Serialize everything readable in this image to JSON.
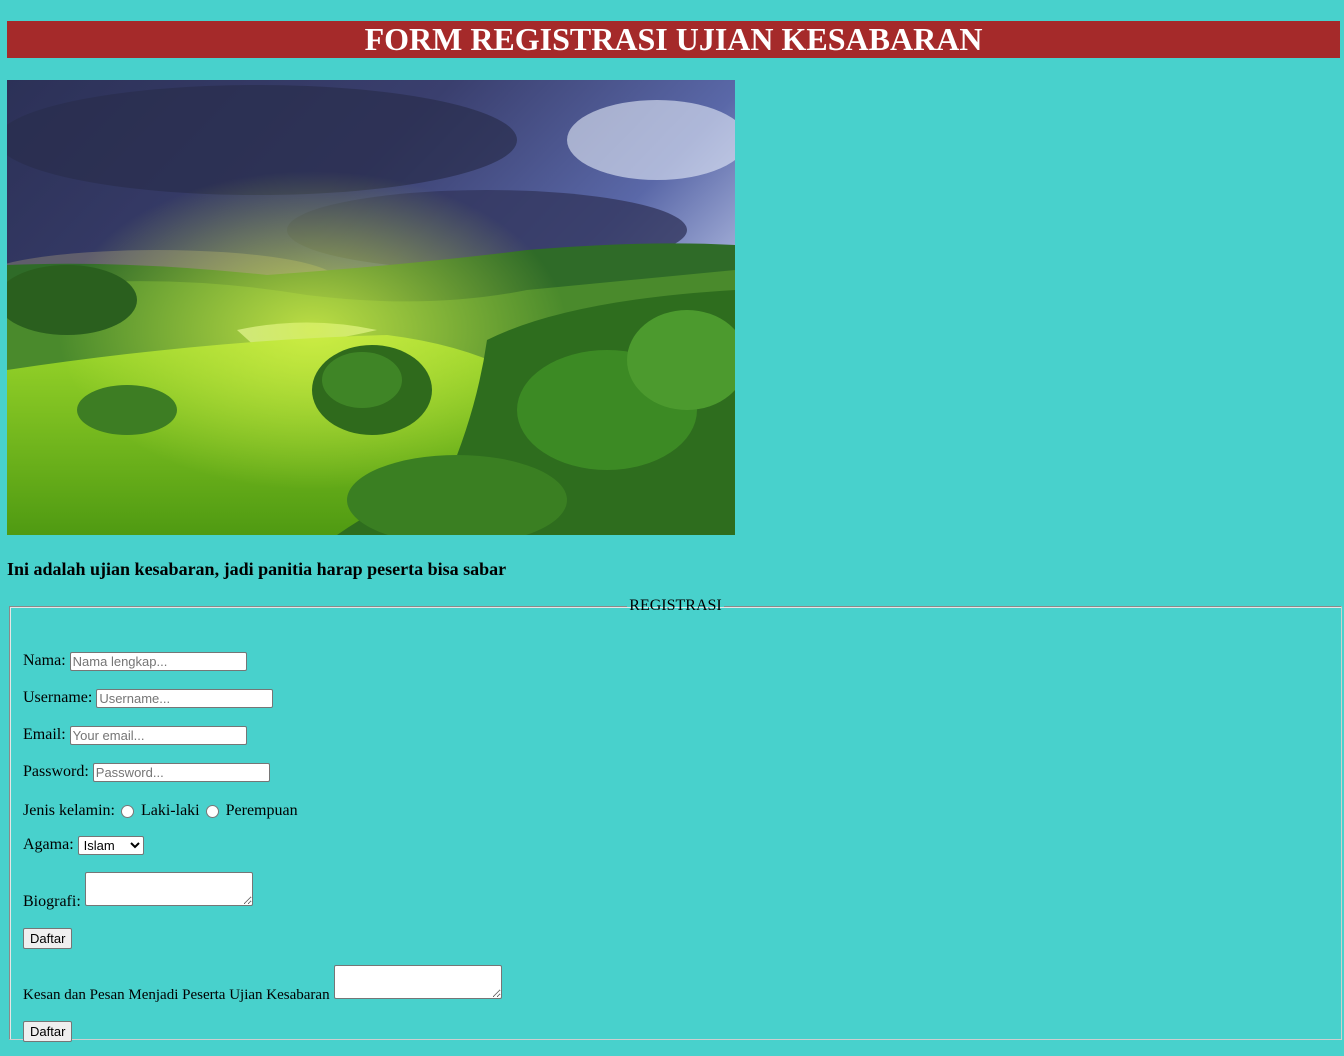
{
  "header": {
    "title": "FORM REGISTRASI UJIAN KESABARAN"
  },
  "intro": {
    "text": "Ini adalah ujian kesabaran, jadi panitia harap peserta bisa sabar"
  },
  "form": {
    "legend": "REGISTRASI",
    "nama": {
      "label": "Nama:",
      "placeholder": "Nama lengkap..."
    },
    "username": {
      "label": "Username:",
      "placeholder": "Username..."
    },
    "email": {
      "label": "Email:",
      "placeholder": "Your email..."
    },
    "password": {
      "label": "Password:",
      "placeholder": "Password..."
    },
    "gender": {
      "label": "Jenis kelamin:",
      "options": [
        "Laki-laki",
        "Perempuan"
      ]
    },
    "agama": {
      "label": "Agama:",
      "selected": "Islam"
    },
    "biografi": {
      "label": "Biografi:"
    },
    "submit1": "Daftar",
    "kesan": {
      "label": "Kesan dan Pesan Menjadi Peserta Ujian Kesabaran"
    },
    "submit2": "Daftar"
  },
  "colors": {
    "background": "#48d1cc",
    "header": "#a52a2a"
  }
}
